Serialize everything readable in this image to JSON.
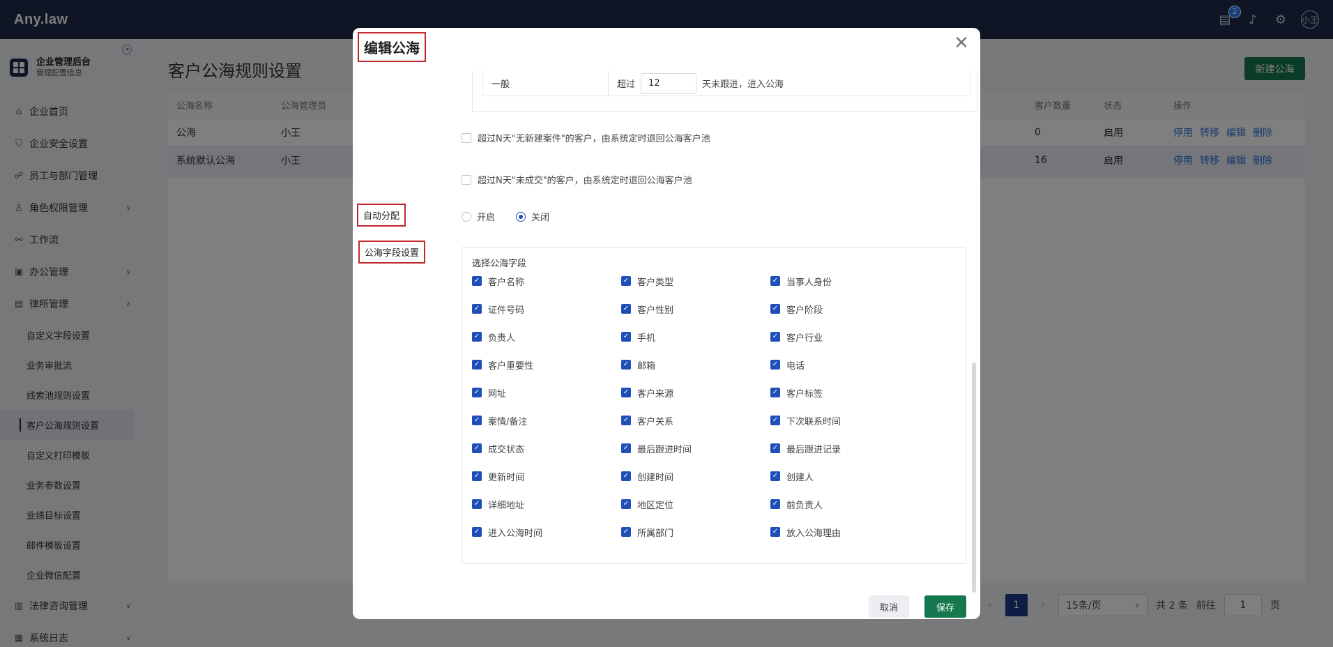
{
  "app": {
    "logo": "Any.law",
    "notification_count": "2",
    "avatar_text": "小王"
  },
  "sidebar": {
    "head_title": "企业管理后台",
    "head_sub": "管理配置信息",
    "items": [
      {
        "label": "企业首页",
        "icon": "home-icon",
        "glyph": "⌂"
      },
      {
        "label": "企业安全设置",
        "icon": "shield-icon",
        "glyph": "⛉"
      },
      {
        "label": "员工与部门管理",
        "icon": "users-icon",
        "glyph": "☍"
      },
      {
        "label": "角色权限管理",
        "icon": "user-icon",
        "glyph": "♙",
        "expand": "collapsed"
      },
      {
        "label": "工作流",
        "icon": "workflow-icon",
        "glyph": "⚯"
      },
      {
        "label": "办公管理",
        "icon": "briefcase-icon",
        "glyph": "▣",
        "expand": "collapsed"
      },
      {
        "label": "律所管理",
        "icon": "document-icon",
        "glyph": "▤",
        "expand": "expanded"
      }
    ],
    "sub_items": [
      "自定义字段设置",
      "业务审批流",
      "线索池规则设置",
      "客户公海规则设置",
      "自定义打印模板",
      "业务参数设置",
      "业绩目标设置",
      "邮件模板设置",
      "企业微信配置"
    ],
    "bottom_items": [
      {
        "label": "法律咨询管理",
        "icon": "clipboard-icon",
        "glyph": "▥"
      },
      {
        "label": "系统日志",
        "icon": "log-icon",
        "glyph": "▦"
      }
    ]
  },
  "page": {
    "title": "客户公海规则设置",
    "new_button": "新建公海",
    "columns": [
      "公海名称",
      "公海管理员",
      "客户数量",
      "状态",
      "操作"
    ],
    "rows": [
      {
        "name": "公海",
        "admin": "小王",
        "count": "0",
        "status": "启用"
      },
      {
        "name": "系统默认公海",
        "admin": "小王",
        "count": "16",
        "status": "启用"
      }
    ],
    "actions": [
      "停用",
      "转移",
      "编辑",
      "删除"
    ],
    "pager": {
      "current": "1",
      "page_size": "15条/页",
      "total": "共 2 条",
      "goto": "前往",
      "goto_value": "1",
      "page_unit": "页"
    }
  },
  "modal": {
    "title": "编辑公海",
    "rule": {
      "level": "一般",
      "over": "超过",
      "days": "12",
      "suffix": "天未跟进，进入公海"
    },
    "check_no_case": "超过N天\"无新建案件\"的客户，由系统定时退回公海客户池",
    "check_no_deal": "超过N天\"未成交\"的客户，由系统定时退回公海客户池",
    "auto_assign_label": "自动分配",
    "auto_on": "开启",
    "auto_off": "关闭",
    "fields_label": "公海字段设置",
    "fields_title": "选择公海字段",
    "fields": [
      "客户名称",
      "客户类型",
      "当事人身份",
      "证件号码",
      "客户性别",
      "客户阶段",
      "负责人",
      "手机",
      "客户行业",
      "客户重要性",
      "邮箱",
      "电话",
      "网址",
      "客户来源",
      "客户标签",
      "案情/备注",
      "客户关系",
      "下次联系时间",
      "成交状态",
      "最后跟进时间",
      "最后跟进记录",
      "更新时间",
      "创建时间",
      "创建人",
      "详细地址",
      "地区定位",
      "前负责人",
      "进入公海时间",
      "所属部门",
      "放入公海理由"
    ],
    "cancel": "取消",
    "save": "保存"
  }
}
